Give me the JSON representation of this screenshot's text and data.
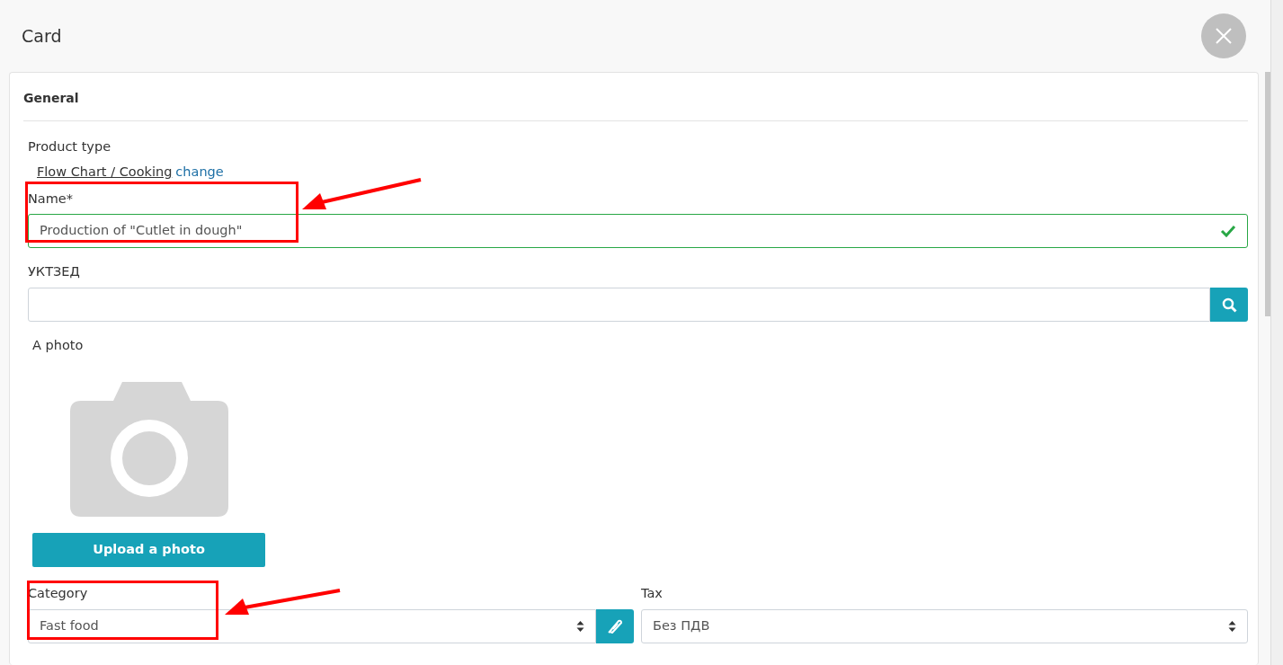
{
  "header": {
    "title": "Card"
  },
  "section": {
    "title": "General"
  },
  "product_type": {
    "label": "Product type",
    "value": "Flow Chart / Cooking",
    "action": "change"
  },
  "name_field": {
    "label": "Name*",
    "value": "Production of \"Cutlet in dough\"",
    "valid": true,
    "highlighted": true
  },
  "code_field": {
    "label": "УКТЗЕД"
  },
  "photo": {
    "label": "A photo",
    "button": "Upload a photo"
  },
  "category": {
    "label": "Category",
    "value": "Fast food",
    "highlighted": true
  },
  "tax": {
    "label": "Tax",
    "value": "Без ПДВ"
  }
}
